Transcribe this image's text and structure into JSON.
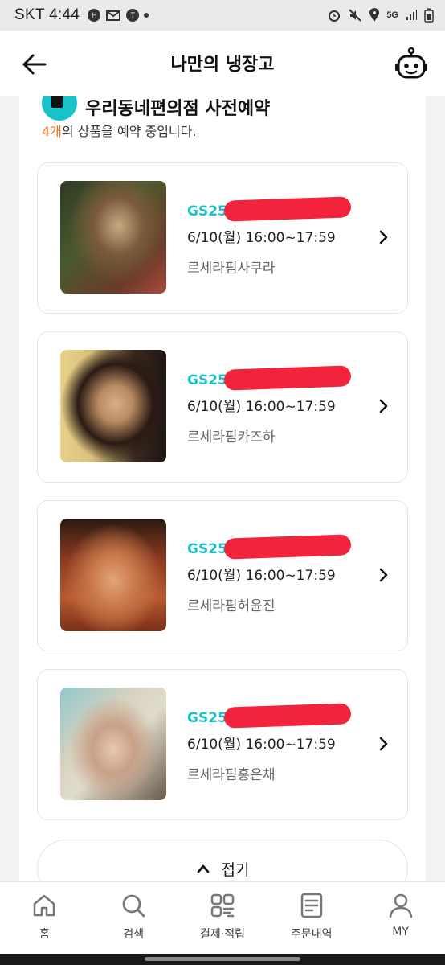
{
  "status_bar": {
    "time": "SKT 4:44",
    "network": "5G"
  },
  "header": {
    "title": "나만의 냉장고",
    "icons": [
      "back-arrow-icon",
      "robot-icon"
    ]
  },
  "brand": {
    "partial_title": "우리동네편의점 사전예약"
  },
  "summary": {
    "count": "4개",
    "text": "의 상품을 예약 중입니다."
  },
  "items": [
    {
      "store": "GS25",
      "time": "6/10(월) 16:00~17:59",
      "name": "르세라핌사쿠라"
    },
    {
      "store": "GS25",
      "time": "6/10(월) 16:00~17:59",
      "name": "르세라핌카즈하"
    },
    {
      "store": "GS25",
      "time": "6/10(월) 16:00~17:59",
      "name": "르세라핌허윤진"
    },
    {
      "store": "GS25",
      "time": "6/10(월) 16:00~17:59",
      "name": "르세라핌홍은채"
    }
  ],
  "fold_button": {
    "label": "접기"
  },
  "bottom_nav": [
    {
      "label": "홈",
      "icon": "home-icon"
    },
    {
      "label": "검색",
      "icon": "search-icon"
    },
    {
      "label": "결제·적립",
      "icon": "pay-icon"
    },
    {
      "label": "주문내역",
      "icon": "order-list-icon"
    },
    {
      "label": "MY",
      "icon": "profile-icon"
    }
  ],
  "colors": {
    "accent": "#1ec0c8",
    "count": "#f0731b",
    "redaction": "#f2243b"
  }
}
